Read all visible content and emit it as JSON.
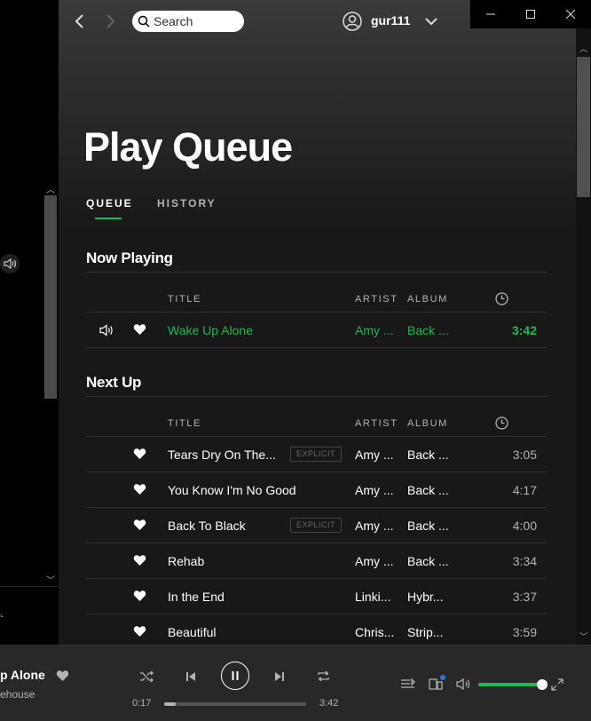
{
  "topbar": {
    "search_placeholder": "Search",
    "username": "gur111"
  },
  "page": {
    "title": "Play Queue",
    "tabs": [
      {
        "label": "QUEUE",
        "active": true
      },
      {
        "label": "HISTORY",
        "active": false
      }
    ]
  },
  "columns": {
    "title": "TITLE",
    "artist": "ARTIST",
    "album": "ALBUM"
  },
  "now_playing": {
    "heading": "Now Playing",
    "track": {
      "title": "Wake Up Alone",
      "artist": "Amy ...",
      "album": "Back ...",
      "duration": "3:42"
    }
  },
  "next_up": {
    "heading": "Next Up",
    "tracks": [
      {
        "title": "Tears Dry On The...",
        "explicit": "EXPLICIT",
        "artist": "Amy ...",
        "album": "Back ...",
        "duration": "3:05"
      },
      {
        "title": "You Know I'm No Good",
        "explicit": "",
        "artist": "Amy ...",
        "album": "Back ...",
        "duration": "4:17"
      },
      {
        "title": "Back To Black",
        "explicit": "EXPLICIT",
        "artist": "Amy ...",
        "album": "Back ...",
        "duration": "4:00"
      },
      {
        "title": "Rehab",
        "explicit": "",
        "artist": "Amy ...",
        "album": "Back ...",
        "duration": "3:34"
      },
      {
        "title": "In the End",
        "explicit": "",
        "artist": "Linki...",
        "album": "Hybr...",
        "duration": "3:37"
      },
      {
        "title": "Beautiful",
        "explicit": "",
        "artist": "Chris...",
        "album": "Strip...",
        "duration": "3:59"
      }
    ]
  },
  "player": {
    "track_title": "p Alone",
    "track_artist": "ehouse",
    "elapsed": "0:17",
    "total": "3:42",
    "progress": 0.08,
    "volume": 1.0
  },
  "colors": {
    "accent": "#1db954"
  }
}
